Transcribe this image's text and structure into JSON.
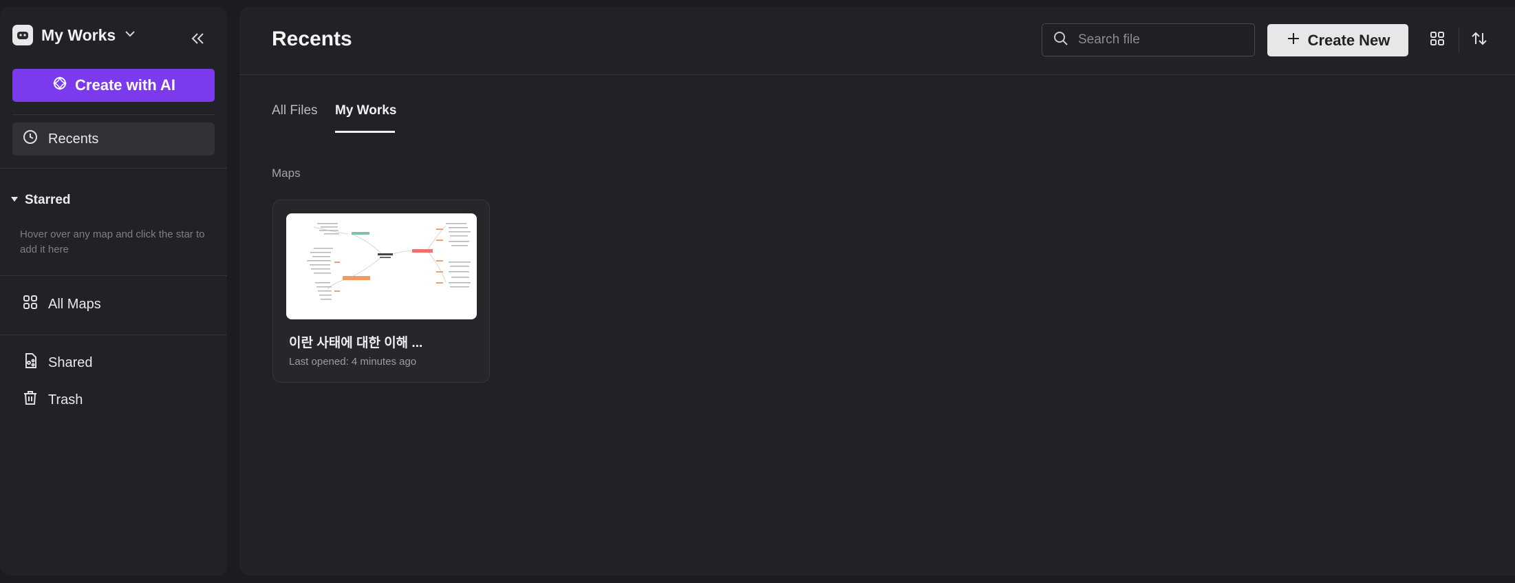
{
  "sidebar": {
    "workspace_name": "My Works",
    "create_ai_label": "Create with AI",
    "recents_label": "Recents",
    "starred_label": "Starred",
    "starred_hint": "Hover over any map and click the star to add it here",
    "all_maps_label": "All Maps",
    "shared_label": "Shared",
    "trash_label": "Trash"
  },
  "header": {
    "title": "Recents",
    "search_placeholder": "Search file",
    "create_new_label": "Create New"
  },
  "tabs": [
    {
      "label": "All Files",
      "active": false
    },
    {
      "label": "My Works",
      "active": true
    }
  ],
  "section_label": "Maps",
  "files": [
    {
      "title": "이란 사태에 대한 이해 ...",
      "meta": "Last opened: 4 minutes ago"
    }
  ],
  "colors": {
    "accent": "#7c3aed",
    "background": "#1b1c1f",
    "panel": "#212226"
  },
  "icons": [
    "workspace-logo-icon",
    "chevron-down-icon",
    "collapse-icon",
    "sparkle-icon",
    "clock-icon",
    "caret-down-icon",
    "grid-icon",
    "shared-file-icon",
    "trash-icon",
    "search-icon",
    "plus-icon",
    "sort-icon"
  ]
}
